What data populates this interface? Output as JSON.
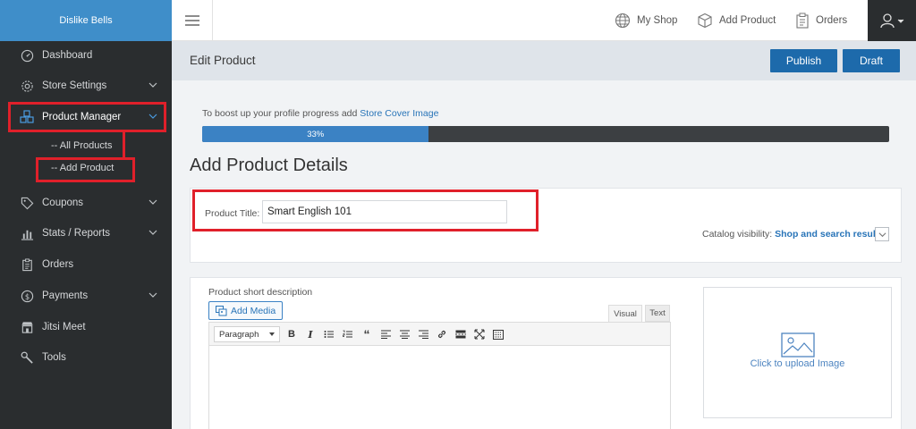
{
  "brand": {
    "name": "Dislike Bells"
  },
  "sidebar": {
    "items": [
      {
        "label": "Dashboard"
      },
      {
        "label": "Store Settings"
      },
      {
        "label": "Product Manager"
      },
      {
        "label": "Coupons"
      },
      {
        "label": "Stats / Reports"
      },
      {
        "label": "Orders"
      },
      {
        "label": "Payments"
      },
      {
        "label": "Jitsi Meet"
      },
      {
        "label": "Tools"
      }
    ],
    "subitems": [
      {
        "label": "-- All Products"
      },
      {
        "label": "-- Add Product"
      }
    ]
  },
  "topbar": {
    "my_shop": "My Shop",
    "add_product": "Add Product",
    "orders": "Orders"
  },
  "page": {
    "title": "Edit Product",
    "publish": "Publish",
    "draft": "Draft"
  },
  "progress": {
    "note": "To boost up your profile progress add ",
    "link": "Store Cover Image",
    "value": 33,
    "label": "33%"
  },
  "section": {
    "title": "Add Product Details"
  },
  "product": {
    "title_label": "Product Title:",
    "title_value": "Smart English 101",
    "visibility_label": "Catalog visibility: ",
    "visibility_value": "Shop and search results"
  },
  "description": {
    "label": "Product short description",
    "add_media": "Add Media",
    "tab_visual": "Visual",
    "tab_text": "Text",
    "format": "Paragraph"
  },
  "upload": {
    "text": "Click to upload Image"
  },
  "colors": {
    "highlight": "#e0202a",
    "accent": "#1d6aab",
    "sidebar": "#2a2d2f"
  }
}
